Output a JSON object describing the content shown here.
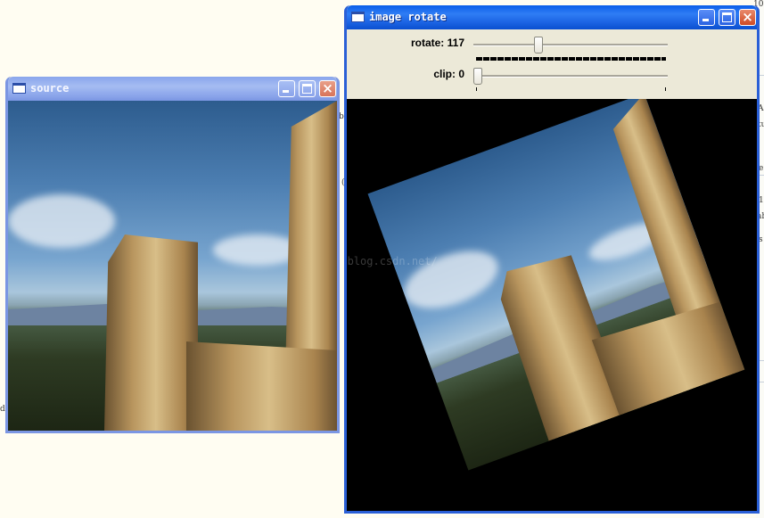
{
  "source_window": {
    "title": "source",
    "buttons": {
      "minimize": "minimize",
      "maximize": "maximize",
      "close": "close"
    }
  },
  "rotate_window": {
    "title": "image rotate",
    "controls": {
      "rotate": {
        "label": "rotate: 117",
        "value": 117,
        "max": 360
      },
      "clip": {
        "label": "clip: 0",
        "value": 0,
        "max": 100
      }
    }
  },
  "watermark": "http://blog.csdn.net/",
  "background_fragments": [
    "10",
    "A",
    "tu",
    "e",
    "1",
    "ah",
    "s",
    "d",
    "b",
    "("
  ],
  "colors": {
    "title_active": "#0a5ee8",
    "title_inactive": "#8aa6ec",
    "window_face": "#ece9d8",
    "rotated_background": "#000000"
  }
}
